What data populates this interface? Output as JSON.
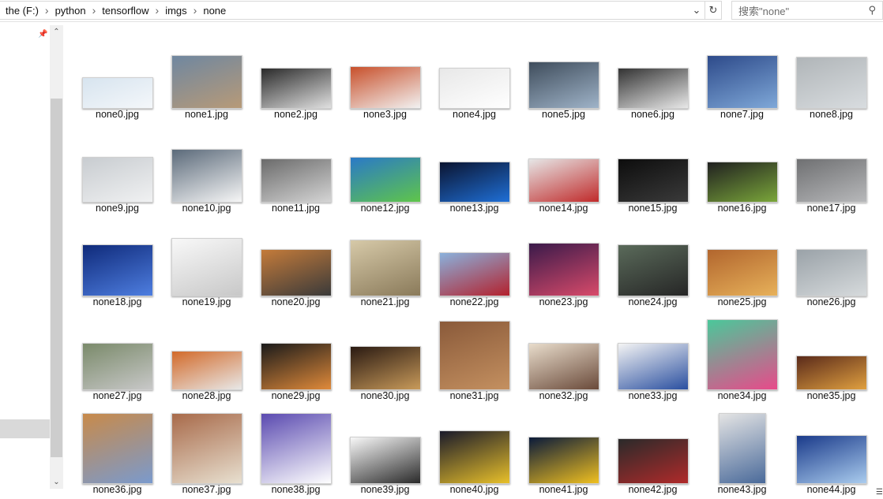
{
  "breadcrumb": [
    "the (F:)",
    "python",
    "tensorflow",
    "imgs",
    "none"
  ],
  "address": {
    "dropdown_icon": "chevron-down-icon",
    "refresh_icon": "refresh-icon"
  },
  "search": {
    "placeholder": "搜索\"none\"",
    "icon": "search-icon"
  },
  "colors": {
    "accent": "#0078d7",
    "selection": "#d9d9d9"
  },
  "files": [
    {
      "name": "none0.jpg",
      "c1": "#d7e4ef",
      "c2": "#f4f7fa"
    },
    {
      "name": "none1.jpg",
      "c1": "#6f87a0",
      "c2": "#b79a78"
    },
    {
      "name": "none2.jpg",
      "c1": "#2a2a2a",
      "c2": "#e0e0e0"
    },
    {
      "name": "none3.jpg",
      "c1": "#c8502b",
      "c2": "#f2f2f2"
    },
    {
      "name": "none4.jpg",
      "c1": "#e8e8e8",
      "c2": "#ffffff"
    },
    {
      "name": "none5.jpg",
      "c1": "#3f4d5c",
      "c2": "#9fb3c8"
    },
    {
      "name": "none6.jpg",
      "c1": "#333333",
      "c2": "#e8e8e8"
    },
    {
      "name": "none7.jpg",
      "c1": "#2d4a8a",
      "c2": "#7fa8d8"
    },
    {
      "name": "none8.jpg",
      "c1": "#b0b5b8",
      "c2": "#d8dcdf"
    },
    {
      "name": "none9.jpg",
      "c1": "#c8ccd0",
      "c2": "#f0f1f2"
    },
    {
      "name": "none10.jpg",
      "c1": "#5b6a7a",
      "c2": "#f6f6f6"
    },
    {
      "name": "none11.jpg",
      "c1": "#6b6b6b",
      "c2": "#d4d4d4"
    },
    {
      "name": "none12.jpg",
      "c1": "#2a79c7",
      "c2": "#5fc54a"
    },
    {
      "name": "none13.jpg",
      "c1": "#0b1430",
      "c2": "#1f6fd6"
    },
    {
      "name": "none14.jpg",
      "c1": "#e6e6e6",
      "c2": "#c02a2a"
    },
    {
      "name": "none15.jpg",
      "c1": "#0d0d0d",
      "c2": "#3a3a3a"
    },
    {
      "name": "none16.jpg",
      "c1": "#202020",
      "c2": "#7aa63a"
    },
    {
      "name": "none17.jpg",
      "c1": "#6f7072",
      "c2": "#b7b8ba"
    },
    {
      "name": "none18.jpg",
      "c1": "#0f2a7a",
      "c2": "#4e7ee0"
    },
    {
      "name": "none19.jpg",
      "c1": "#f8f8f8",
      "c2": "#c8c8c8"
    },
    {
      "name": "none20.jpg",
      "c1": "#c47b3a",
      "c2": "#3a3a3a"
    },
    {
      "name": "none21.jpg",
      "c1": "#d6c9a8",
      "c2": "#8a7a5a"
    },
    {
      "name": "none22.jpg",
      "c1": "#8ab1dc",
      "c2": "#b3212d"
    },
    {
      "name": "none23.jpg",
      "c1": "#3a1a4a",
      "c2": "#d84a6a"
    },
    {
      "name": "none24.jpg",
      "c1": "#5a6a5a",
      "c2": "#262626"
    },
    {
      "name": "none25.jpg",
      "c1": "#b2662e",
      "c2": "#e7b15a"
    },
    {
      "name": "none26.jpg",
      "c1": "#9aa2a8",
      "c2": "#d6dadc"
    },
    {
      "name": "none27.jpg",
      "c1": "#7a8a6a",
      "c2": "#c8c8c8"
    },
    {
      "name": "none28.jpg",
      "c1": "#d26a2a",
      "c2": "#e8e8e8"
    },
    {
      "name": "none29.jpg",
      "c1": "#1a1a1a",
      "c2": "#e08a3a"
    },
    {
      "name": "none30.jpg",
      "c1": "#2a1a12",
      "c2": "#c89a5a"
    },
    {
      "name": "none31.jpg",
      "c1": "#8a5a3a",
      "c2": "#c49060"
    },
    {
      "name": "none32.jpg",
      "c1": "#e8dccb",
      "c2": "#6a4a3a"
    },
    {
      "name": "none33.jpg",
      "c1": "#f4f4f4",
      "c2": "#2a4fa0"
    },
    {
      "name": "none34.jpg",
      "c1": "#4ac89a",
      "c2": "#e84a8a"
    },
    {
      "name": "none35.jpg",
      "c1": "#5a2a1a",
      "c2": "#e0a040"
    },
    {
      "name": "none36.jpg",
      "c1": "#c88a4a",
      "c2": "#7a9acd"
    },
    {
      "name": "none37.jpg",
      "c1": "#a86a4a",
      "c2": "#e8e0d0"
    },
    {
      "name": "none38.jpg",
      "c1": "#5a4ab0",
      "c2": "#ffffff"
    },
    {
      "name": "none39.jpg",
      "c1": "#f8f8f8",
      "c2": "#2a2a2a"
    },
    {
      "name": "none40.jpg",
      "c1": "#1a1a2a",
      "c2": "#e8c02a"
    },
    {
      "name": "none41.jpg",
      "c1": "#0a1a3a",
      "c2": "#f0c020"
    },
    {
      "name": "none42.jpg",
      "c1": "#2a2a2a",
      "c2": "#b02a2a"
    },
    {
      "name": "none43.jpg",
      "c1": "#e4e4e4",
      "c2": "#4a6a9a"
    },
    {
      "name": "none44.jpg",
      "c1": "#1a3a8a",
      "c2": "#aaccee"
    }
  ],
  "status": {
    "view_icon": "details-view-icon"
  }
}
